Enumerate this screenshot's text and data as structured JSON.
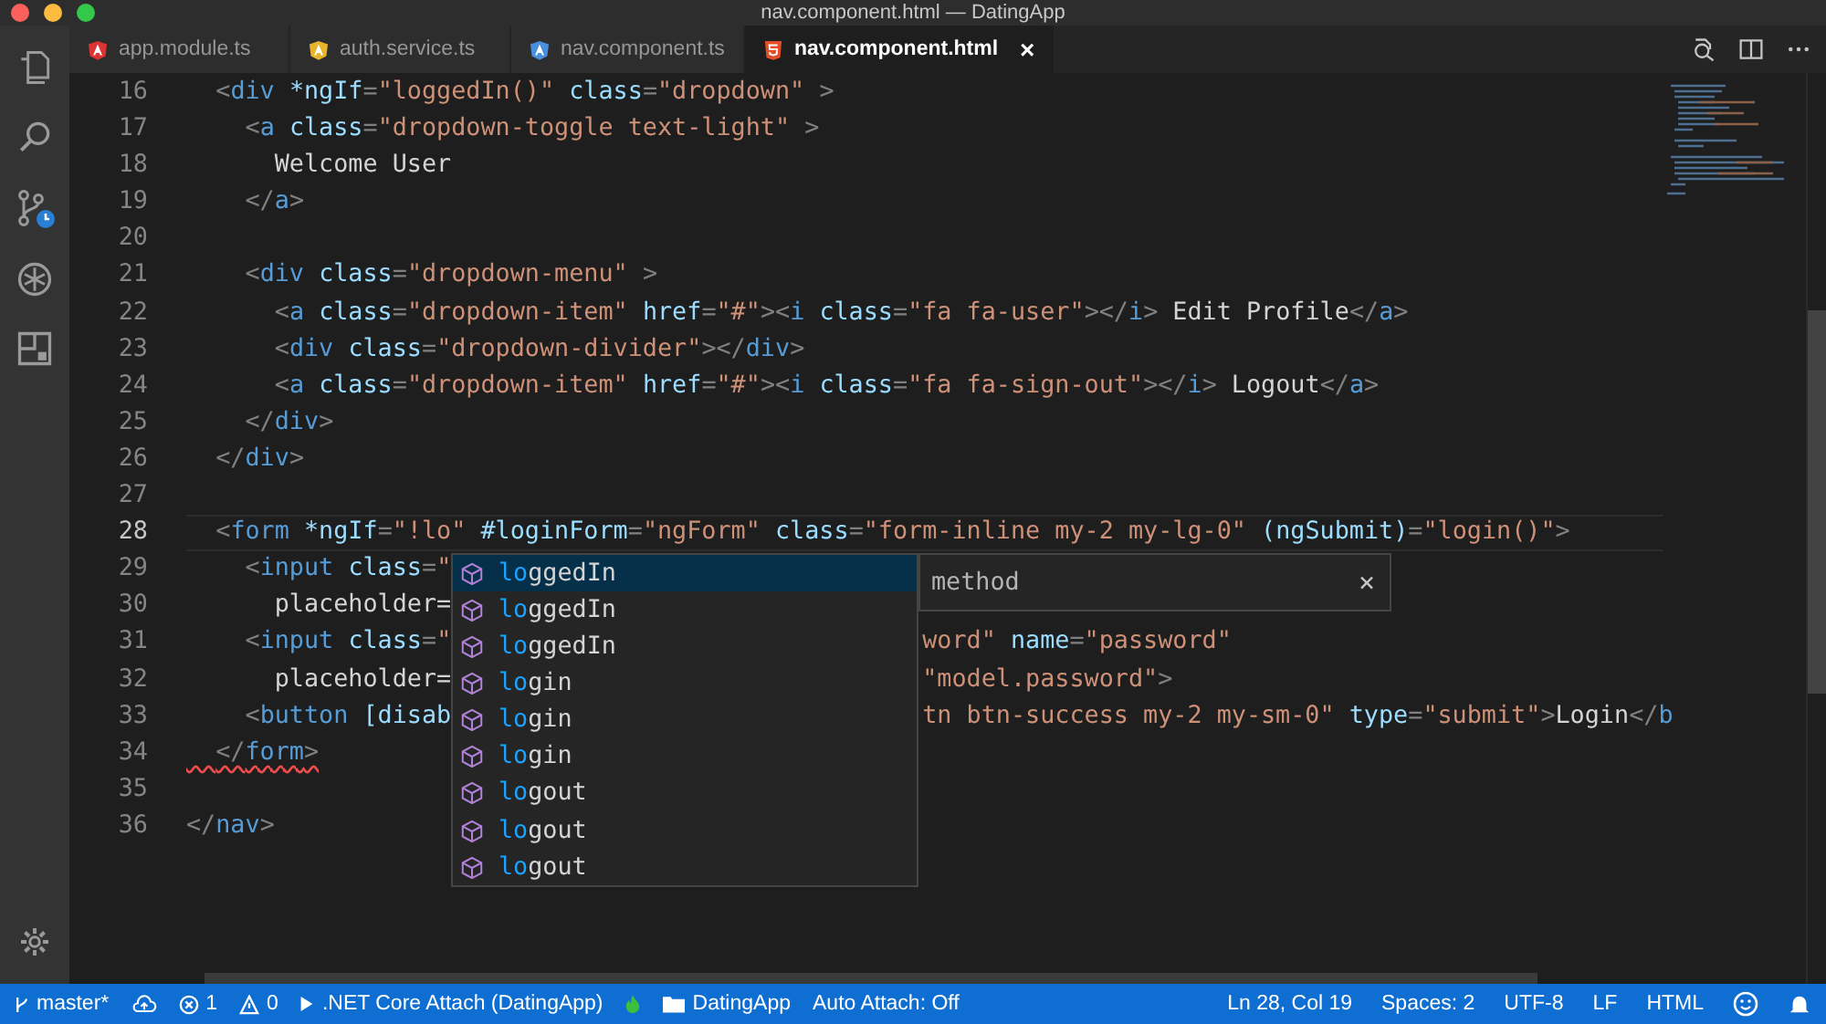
{
  "window": {
    "title": "nav.component.html — DatingApp"
  },
  "activity_bar": {
    "items": [
      {
        "kind": "files"
      },
      {
        "kind": "search"
      },
      {
        "kind": "scm"
      },
      {
        "kind": "debug"
      },
      {
        "kind": "extensions"
      }
    ],
    "bottom": [
      {
        "kind": "settings"
      }
    ]
  },
  "tabs": [
    {
      "label": "app.module.ts",
      "kind": "angular",
      "color": "#dd3333",
      "selected": false
    },
    {
      "label": "auth.service.ts",
      "kind": "angular",
      "color": "#e8b42a",
      "selected": false
    },
    {
      "label": "nav.component.ts",
      "kind": "angular",
      "color": "#4a8fdd",
      "selected": false
    },
    {
      "label": "nav.component.html",
      "kind": "html5",
      "color": "#e44d26",
      "selected": true,
      "close": "×"
    }
  ],
  "editor": {
    "lines": [
      {
        "number": "16",
        "current": false,
        "code": "  <div *ngIf=\"loggedIn()\" class=\"dropdown\" >"
      },
      {
        "number": "17",
        "current": false,
        "code": "    <a class=\"dropdown-toggle text-light\" >"
      },
      {
        "number": "18",
        "current": false,
        "code": "      Welcome User"
      },
      {
        "number": "19",
        "current": false,
        "code": "    </a>"
      },
      {
        "number": "20",
        "current": false
      },
      {
        "number": "21",
        "current": false,
        "code": "    <div class=\"dropdown-menu\" >"
      },
      {
        "number": "22",
        "current": false,
        "code": "      <a class=\"dropdown-item\" href=\"#\"><i class=\"fa fa-user\"></i> Edit Profile</a>"
      },
      {
        "number": "23",
        "current": false,
        "code": "      <div class=\"dropdown-divider\"></div>"
      },
      {
        "number": "24",
        "current": false,
        "code": "      <a class=\"dropdown-item\" href=\"#\"><i class=\"fa fa-sign-out\"></i> Logout</a>"
      },
      {
        "number": "25",
        "current": false,
        "code": "    </div>"
      },
      {
        "number": "26",
        "current": false,
        "code": "  </div>"
      },
      {
        "number": "27",
        "current": false
      },
      {
        "number": "28",
        "current": true,
        "code": "  <form *ngIf=\"!lo\" #loginForm=\"ngForm\" class=\"form-inline my-2 my-lg-0\" (ngSubmit)=\"login()\">"
      },
      {
        "number": "29",
        "current": false,
        "code": "    <input class=\""
      },
      {
        "number": "30",
        "current": false,
        "code": "      placeholder="
      },
      {
        "number": "31",
        "current": false,
        "code": "    <input class=\"",
        "tail": "word\" name=\"password\""
      },
      {
        "number": "32",
        "current": false,
        "code": "      placeholder=",
        "tail": "\"model.password\">"
      },
      {
        "number": "33",
        "current": false,
        "code": "    <button [disab",
        "tail": "tn btn-success my-2 my-sm-0\" type=\"submit\">Login</b"
      },
      {
        "number": "34",
        "current": false,
        "error": true,
        "code": "  </form>"
      },
      {
        "number": "35",
        "current": false
      },
      {
        "number": "36",
        "current": false,
        "code": "</nav>"
      }
    ],
    "suggestions": {
      "items": [
        {
          "label": "**lo**ggedIn",
          "selected": true
        },
        {
          "label": "**lo**ggedIn",
          "selected": false
        },
        {
          "label": "**lo**ggedIn",
          "selected": false
        },
        {
          "label": "**lo**gin",
          "selected": false
        },
        {
          "label": "**lo**gin",
          "selected": false
        },
        {
          "label": "**lo**gin",
          "selected": false
        },
        {
          "label": "**lo**gout",
          "selected": false
        },
        {
          "label": "**lo**gout",
          "selected": false
        },
        {
          "label": "**lo**gout",
          "selected": false
        }
      ],
      "detail": {
        "text": "method",
        "close": "×"
      }
    }
  },
  "status_bar": {
    "left": [
      {
        "kind": "branch",
        "text": "master*"
      },
      {
        "kind": "sync"
      },
      {
        "kind": "errors",
        "text": "1"
      },
      {
        "kind": "warnings",
        "text": "0"
      },
      {
        "kind": "debug",
        "text": ".NET Core Attach (DatingApp)"
      },
      {
        "kind": "flame"
      },
      {
        "kind": "folder",
        "text": "DatingApp"
      },
      {
        "kind": "plain",
        "text": "Auto Attach: Off"
      }
    ],
    "right": [
      {
        "kind": "plain",
        "text": "Ln 28, Col 19"
      },
      {
        "kind": "plain",
        "text": "Spaces: 2"
      },
      {
        "kind": "plain",
        "text": "UTF-8"
      },
      {
        "kind": "plain",
        "text": "LF"
      },
      {
        "kind": "plain",
        "text": "HTML"
      },
      {
        "kind": "feedback"
      },
      {
        "kind": "bell"
      }
    ]
  }
}
